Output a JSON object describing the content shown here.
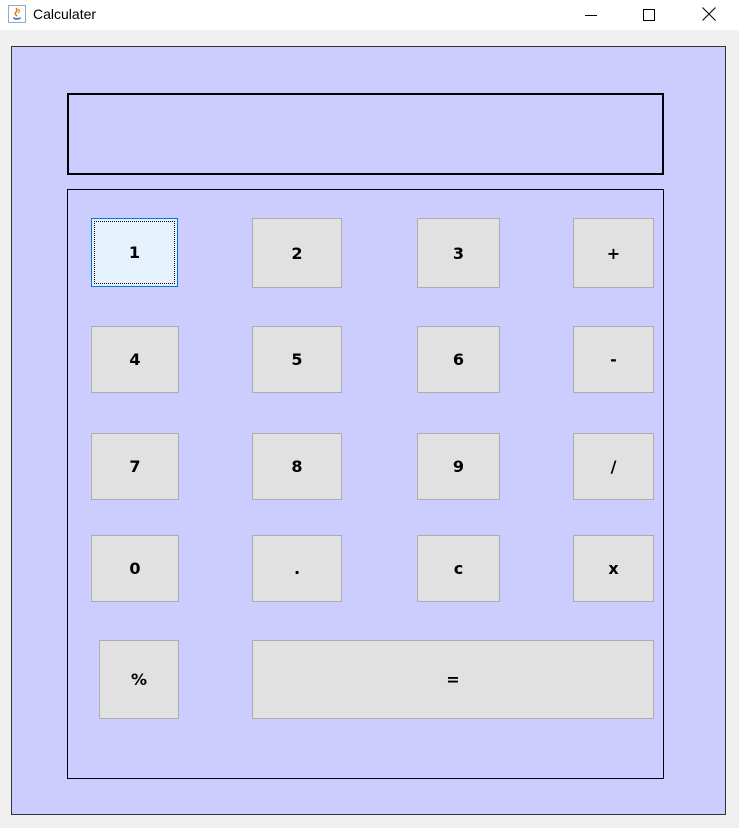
{
  "window": {
    "title": "Calculater",
    "controls": {
      "minimize": "minimize-icon",
      "maximize": "maximize-icon",
      "close": "close-icon"
    }
  },
  "display": {
    "value": ""
  },
  "keys": {
    "k1": "1",
    "k2": "2",
    "k3": "3",
    "plus": "+",
    "k4": "4",
    "k5": "5",
    "k6": "6",
    "minus": "-",
    "k7": "7",
    "k8": "8",
    "k9": "9",
    "divide": "/",
    "k0": "0",
    "dot": ".",
    "clear": "c",
    "multiply": "x",
    "percent": "%",
    "equals": "="
  },
  "colors": {
    "background": "#ccccff",
    "button": "#e1e1e1",
    "focused_button": "#e5f1fb",
    "focus_border": "#0078d7"
  }
}
